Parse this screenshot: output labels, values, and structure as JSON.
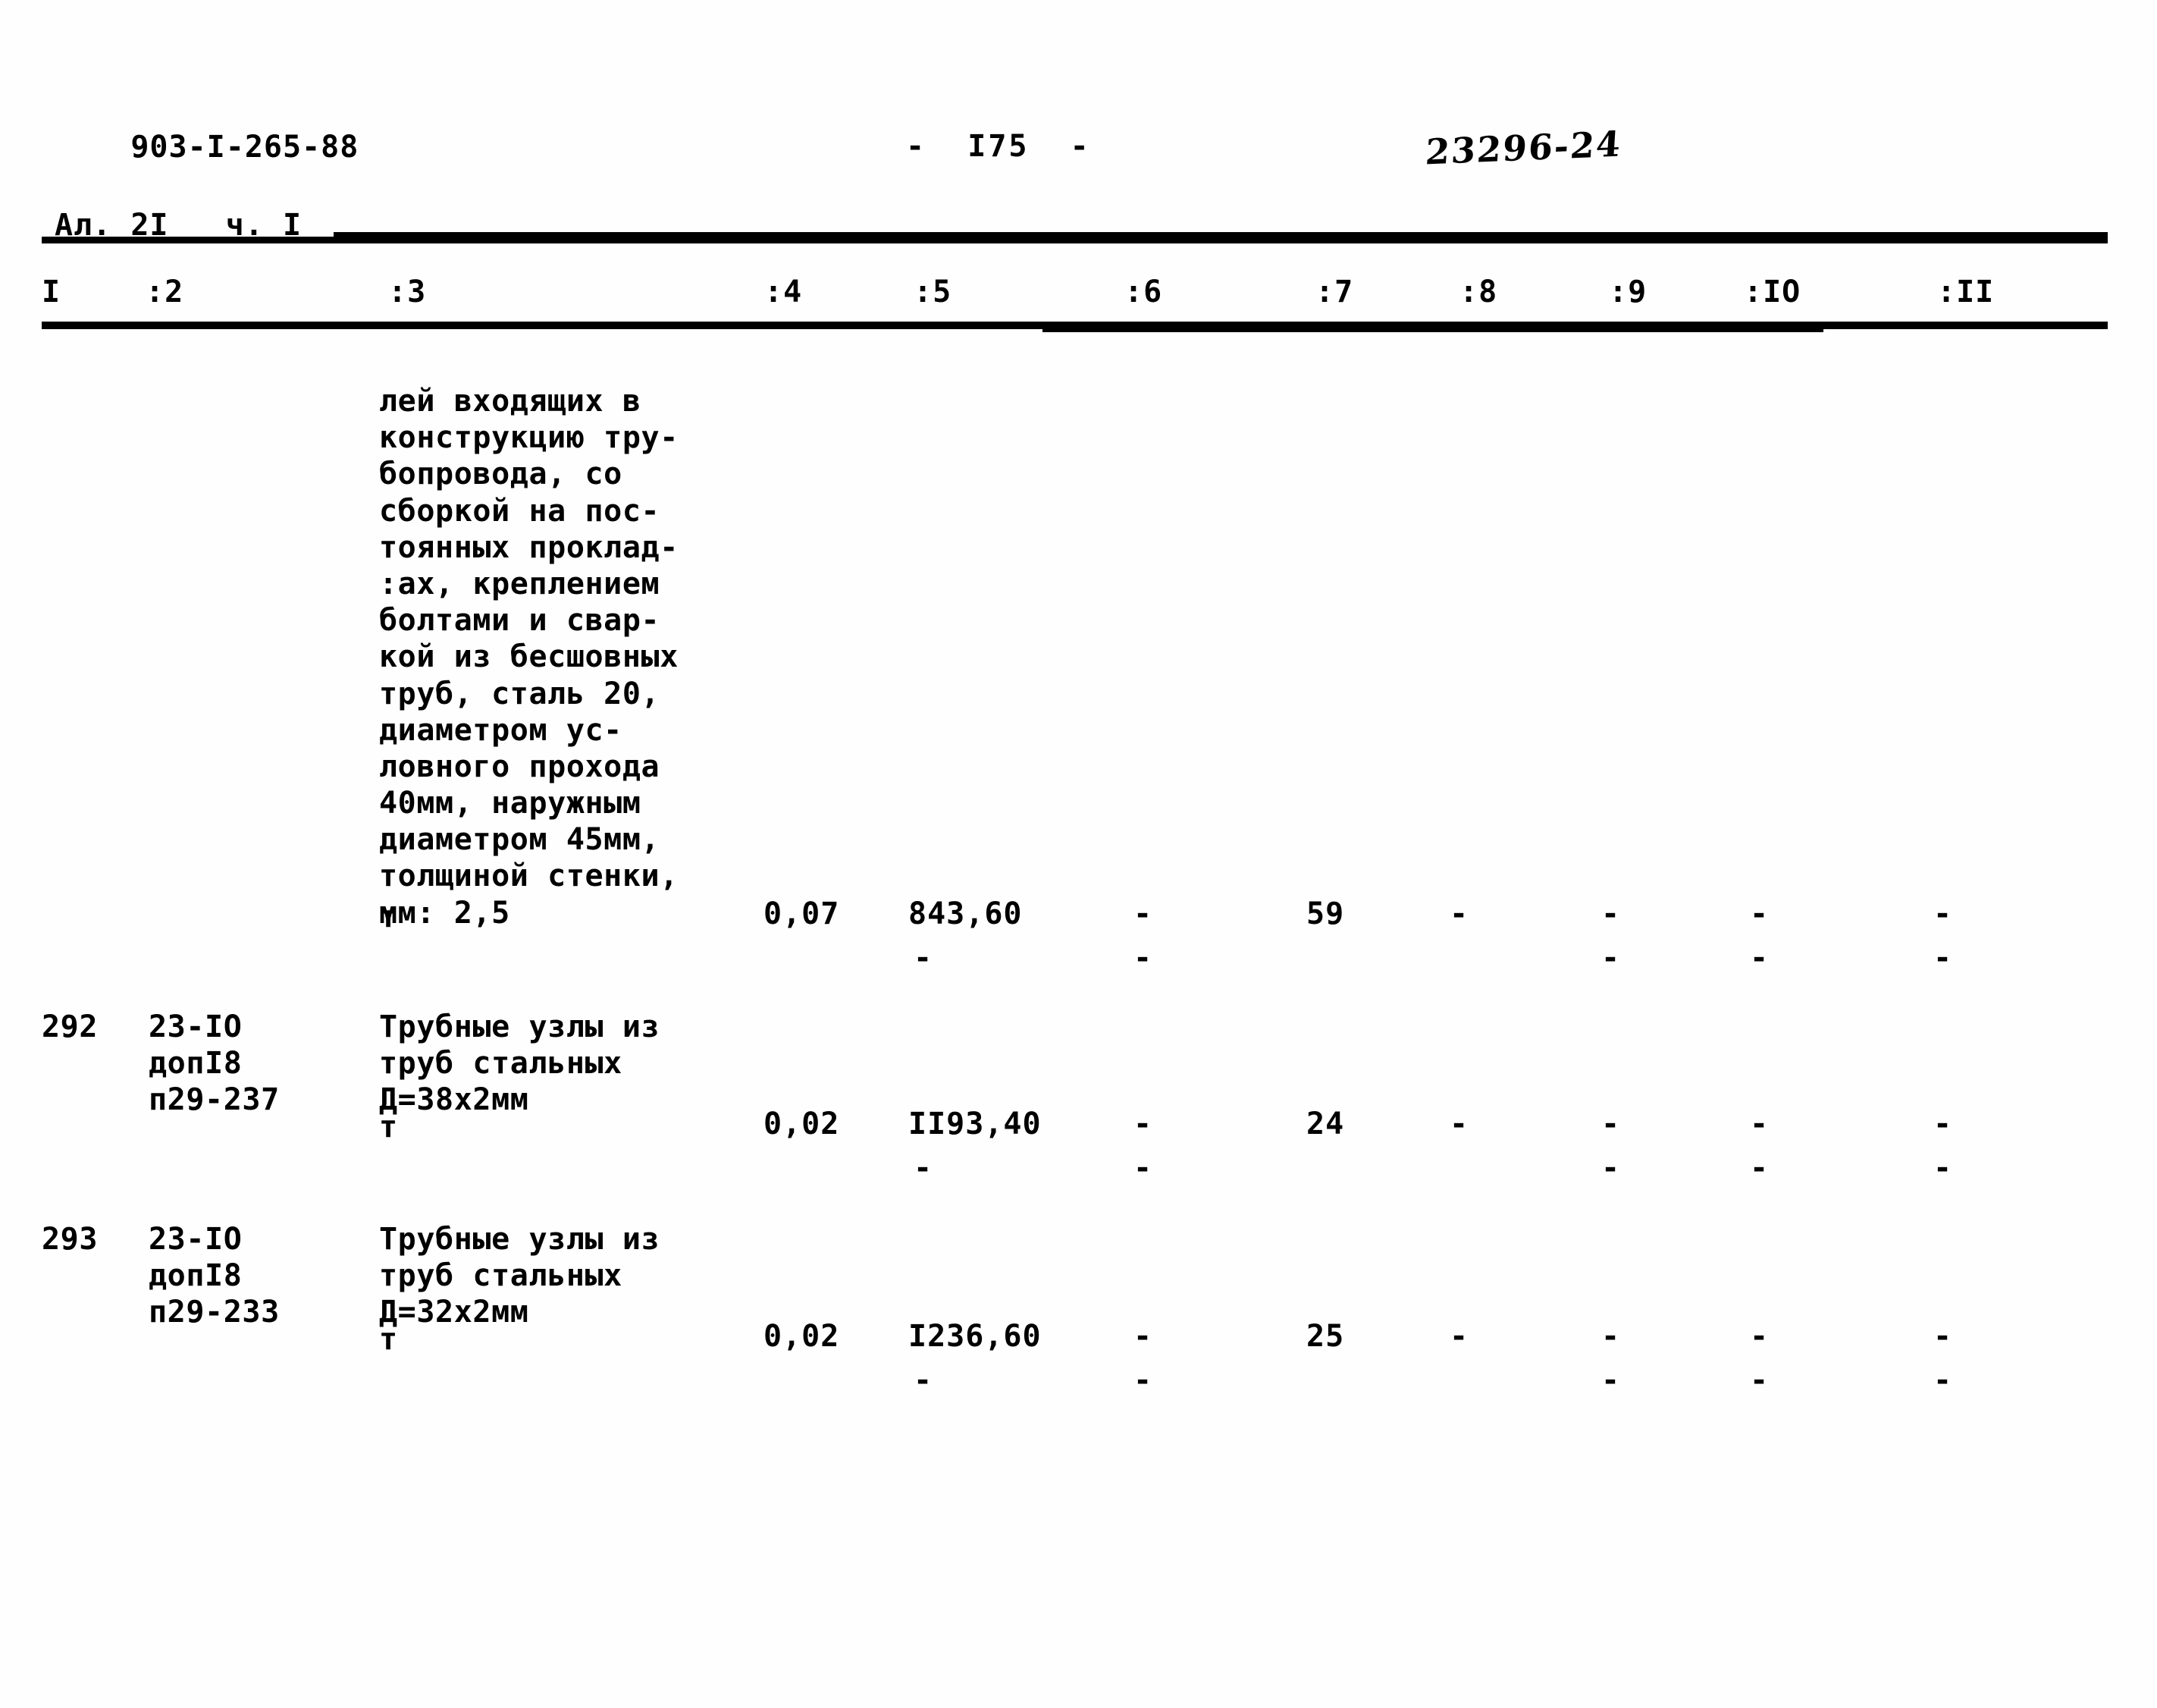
{
  "document": {
    "code_line1": "903-I-265-88",
    "code_line2": "Ал. 2I   ч. I",
    "page_marker": "-  I75  -",
    "handwritten_stamp": "23296-24"
  },
  "table": {
    "headers": [
      "I",
      ":2",
      ":3",
      ":4",
      ":5",
      ":6",
      ":7",
      ":8",
      ":9",
      ":IO",
      ":II"
    ],
    "rows": [
      {
        "no": "",
        "code": "",
        "description": "лей входящих в\nконструкцию тру-\nбопровода, со\nсборкой на пос-\nтоянных проклад-\n:ах, креплением\nболтами и свар-\nкой из бесшовных\nтруб, сталь 20,\nдиаметром ус-\nловного прохода\n40мм, наружным\nдиаметром 45мм,\nтолщиной стенки,\nмм: 2,5",
        "unit": "т",
        "c4": "0,07",
        "c5": "843,60",
        "c5b": "-",
        "c6": "-",
        "c6b": "-",
        "c7": "59",
        "c8": "-",
        "c8b": "",
        "c9": "-",
        "c9b": "-",
        "c10": "-",
        "c10b": "-",
        "c11": "-",
        "c11b": "-"
      },
      {
        "no": "292",
        "code": "23-IO\nдопI8\nп29-237",
        "description": "Трубные узлы из\nтруб стальных\nД=38х2мм",
        "unit": "т",
        "c4": "0,02",
        "c5": "II93,40",
        "c5b": "-",
        "c6": "-",
        "c6b": "-",
        "c7": "24",
        "c8": "-",
        "c8b": "",
        "c9": "-",
        "c9b": "-",
        "c10": "-",
        "c10b": "-",
        "c11": "-",
        "c11b": "-"
      },
      {
        "no": "293",
        "code": "23-IO\nдопI8\nп29-233",
        "description": "Трубные узлы из\nтруб стальных\nД=32х2мм",
        "unit": "т",
        "c4": "0,02",
        "c5": "I236,60",
        "c5b": "-",
        "c6": "-",
        "c6b": "-",
        "c7": "25",
        "c8": "-",
        "c8b": "",
        "c9": "-",
        "c9b": "-",
        "c10": "-",
        "c10b": "-",
        "c11": "-",
        "c11b": "-"
      }
    ]
  }
}
